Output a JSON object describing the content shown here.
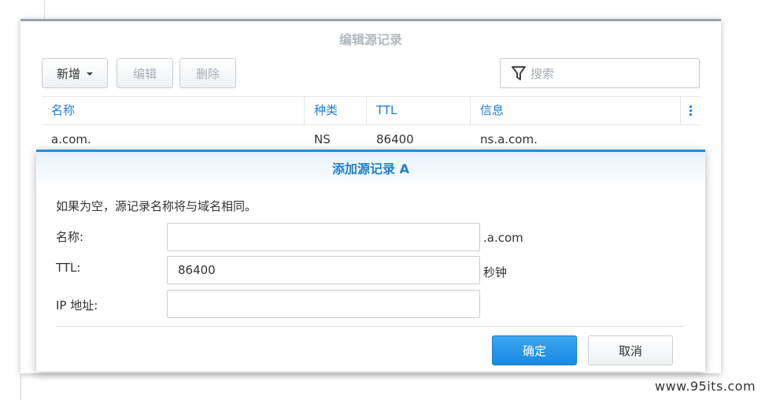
{
  "outer_dialog": {
    "title": "编辑源记录",
    "toolbar": {
      "new_label": "新增",
      "edit_label": "编辑",
      "delete_label": "删除"
    },
    "search": {
      "placeholder": "搜索"
    },
    "columns": [
      "名称",
      "种类",
      "TTL",
      "信息"
    ],
    "rows": [
      {
        "name": "a.com.",
        "type": "NS",
        "ttl": "86400",
        "info": "ns.a.com."
      }
    ]
  },
  "inner_dialog": {
    "title": "添加源记录 A",
    "hint": "如果为空，源记录名称将与域名相同。",
    "fields": {
      "name": {
        "label": "名称:",
        "value": "",
        "suffix": ".a.com"
      },
      "ttl": {
        "label": "TTL:",
        "value": "86400",
        "suffix": "秒钟"
      },
      "ip": {
        "label": "IP 地址:",
        "value": ""
      }
    },
    "ok_label": "确定",
    "cancel_label": "取消"
  },
  "watermark": "www.95its.com",
  "colors": {
    "accent": "#1e7fd4",
    "primary_button": "#1a8ae0",
    "disabled_text": "#a9b0b7"
  }
}
